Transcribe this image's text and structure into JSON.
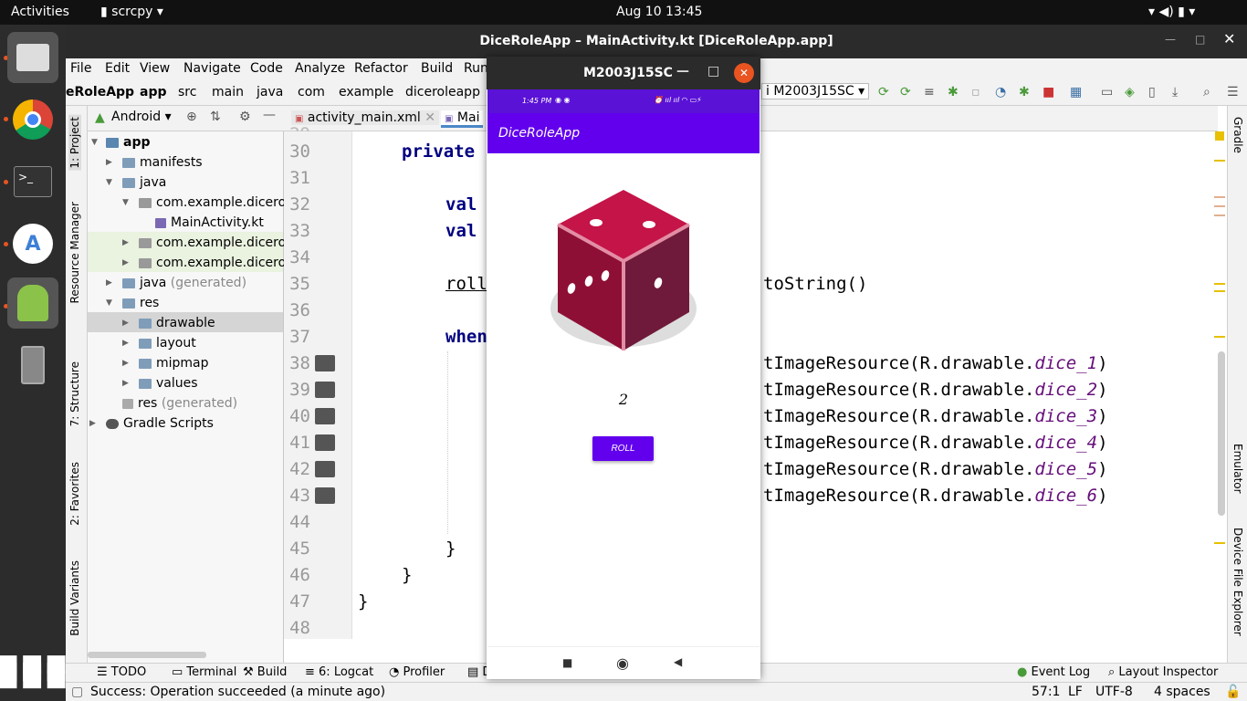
{
  "topbar": {
    "activities": "Activities",
    "app": "scrcpy",
    "datetime": "Aug 10  13:45"
  },
  "window": {
    "title": "DiceRoleApp – MainActivity.kt [DiceRoleApp.app]"
  },
  "menu": [
    "File",
    "Edit",
    "View",
    "Navigate",
    "Code",
    "Analyze",
    "Refactor",
    "Build",
    "Run"
  ],
  "breadcrumb": [
    "eRoleApp",
    "app",
    "src",
    "main",
    "java",
    "com",
    "example",
    "diceroleapp"
  ],
  "device_selector": "M2003J15SC",
  "project": {
    "view": "Android",
    "items": [
      {
        "label": "app"
      },
      {
        "label": "manifests"
      },
      {
        "label": "java"
      },
      {
        "label": "com.example.dicerol"
      },
      {
        "label": "MainActivity.kt"
      },
      {
        "label": "com.example.dicerol"
      },
      {
        "label": "com.example.dicerol"
      },
      {
        "label": "java",
        "suffix": "(generated)"
      },
      {
        "label": "res"
      },
      {
        "label": "drawable"
      },
      {
        "label": "layout"
      },
      {
        "label": "mipmap"
      },
      {
        "label": "values"
      },
      {
        "label": "res",
        "suffix": "(generated)"
      },
      {
        "label": "Gradle Scripts"
      }
    ]
  },
  "left_tabs": [
    "1: Project",
    "Resource Manager",
    "7: Structure",
    "2: Favorites",
    "Build Variants"
  ],
  "right_tabs": [
    "Gradle",
    "Emulator",
    "Device File Explorer"
  ],
  "editor_tabs": [
    "activity_main.xml",
    "Mai"
  ],
  "code": {
    "lines": [
      "30",
      "31",
      "32",
      "33",
      "34",
      "35",
      "36",
      "37",
      "38",
      "39",
      "40",
      "41",
      "42",
      "43",
      "44",
      "45",
      "46",
      "47",
      "48"
    ],
    "l30": "private",
    "l32": "val",
    "l33": "val",
    "l35a": "roll",
    "l35b": "toString()",
    "l37": "when",
    "l38": "tImageResource(R.drawable.",
    "l38i": "dice_1",
    "l39": "tImageResource(R.drawable.",
    "l39i": "dice_2",
    "l40": "tImageResource(R.drawable.",
    "l40i": "dice_3",
    "l41": "tImageResource(R.drawable.",
    "l41i": "dice_4",
    "l42": "tImageResource(R.drawable.",
    "l42i": "dice_5",
    "l43": "tImageResource(R.drawable.",
    "l43i": "dice_6",
    "close": ")",
    "brace": "}"
  },
  "bottom_tools": [
    "TODO",
    "Terminal",
    "Build",
    "6: Logcat",
    "Profiler",
    "D"
  ],
  "bottom_right": [
    "Event Log",
    "Layout Inspector"
  ],
  "status": {
    "message": "Success: Operation succeeded (a minute ago)",
    "position": "57:1",
    "line_sep": "LF",
    "encoding": "UTF-8",
    "indent": "4 spaces"
  },
  "scrcpy": {
    "title": "M2003J15SC",
    "phone_time": "1:45 PM",
    "app_title": "DiceRoleApp",
    "dice_result": "2",
    "roll_label": "ROLL"
  }
}
